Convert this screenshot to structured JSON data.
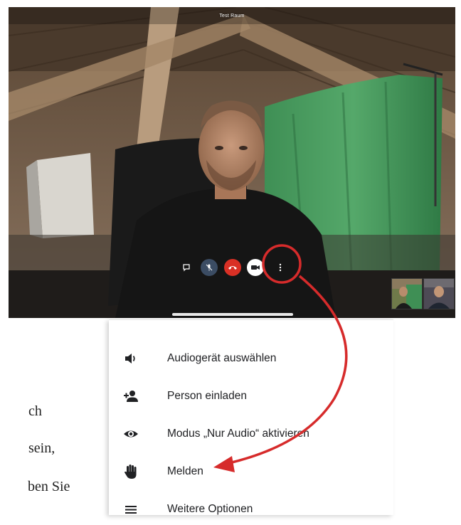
{
  "call": {
    "room_title": "Test Raum",
    "controls": [
      {
        "name": "chat-icon"
      },
      {
        "name": "mic-off-icon"
      },
      {
        "name": "hang-up-icon"
      },
      {
        "name": "camera-icon"
      },
      {
        "name": "more-vertical-icon"
      }
    ],
    "colors": {
      "hangup": "#d93025",
      "mic": "#3b4c63",
      "annotation": "#d62b2b"
    }
  },
  "menu": {
    "items": [
      {
        "label": "Audiogerät auswählen",
        "icon": "speaker-icon"
      },
      {
        "label": "Person einladen",
        "icon": "add-person-icon"
      },
      {
        "label": "Modus „Nur Audio“ aktivieren",
        "icon": "eye-icon"
      },
      {
        "label": "Melden",
        "icon": "hand-icon"
      },
      {
        "label": "Weitere Optionen",
        "icon": "menu-lines-icon"
      }
    ]
  },
  "page_text": {
    "line1": "ch",
    "line2": "sein,",
    "line3": "ben Sie"
  }
}
